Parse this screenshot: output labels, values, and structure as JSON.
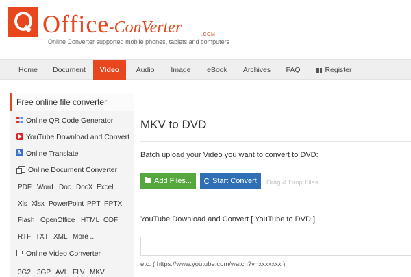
{
  "brand": {
    "logo_office": "Office",
    "logo_dash": "-",
    "logo_converter": "ConVerter",
    "logo_com": ".COM",
    "tagline": "Online Converter supported mobile phones, tablets and computers",
    "accent_color": "#e8471e"
  },
  "nav": {
    "items": [
      "Home",
      "Document",
      "Video",
      "Audio",
      "Image",
      "eBook",
      "Archives",
      "FAQ",
      "Register"
    ],
    "active": "Video"
  },
  "sidebar": {
    "title": "Free online file converter",
    "links": [
      {
        "label": "Online QR Code Generator",
        "icon": "qr-code-icon"
      },
      {
        "label": "YouTube Download and Convert",
        "icon": "youtube-icon"
      },
      {
        "label": "Online Translate",
        "icon": "translate-icon"
      },
      {
        "label": "Online Document Converter",
        "icon": "document-icon"
      },
      {
        "label": "Online Video Converter",
        "icon": "video-icon"
      }
    ],
    "doc_formats": [
      "PDF",
      "Word",
      "Doc",
      "DocX",
      "Excel",
      "Xls",
      "Xlsx",
      "PowerPoint",
      "PPT",
      "PPTX",
      "Flash",
      "OpenOffice",
      "HTML",
      "ODF",
      "RTF",
      "TXT",
      "XML",
      "More ..."
    ],
    "video_formats": [
      "3G2",
      "3GP",
      "AVI",
      "FLV",
      "MKV"
    ]
  },
  "main": {
    "title": "MKV to DVD",
    "upload_label": "Batch upload your Video you want to convert to DVD:",
    "add_files": "Add Files...",
    "start_convert": "Start Convert",
    "drag_drop": "Drag & Drop Files ...",
    "youtube_label": "YouTube Download and Convert [ YouTube to DVD ]",
    "youtube_value": "",
    "youtube_hint": "etc: ( https://www.youtube.com/watch?v=xxxxxxx )",
    "add_color": "#55a83e",
    "convert_color": "#2f6fb5"
  }
}
